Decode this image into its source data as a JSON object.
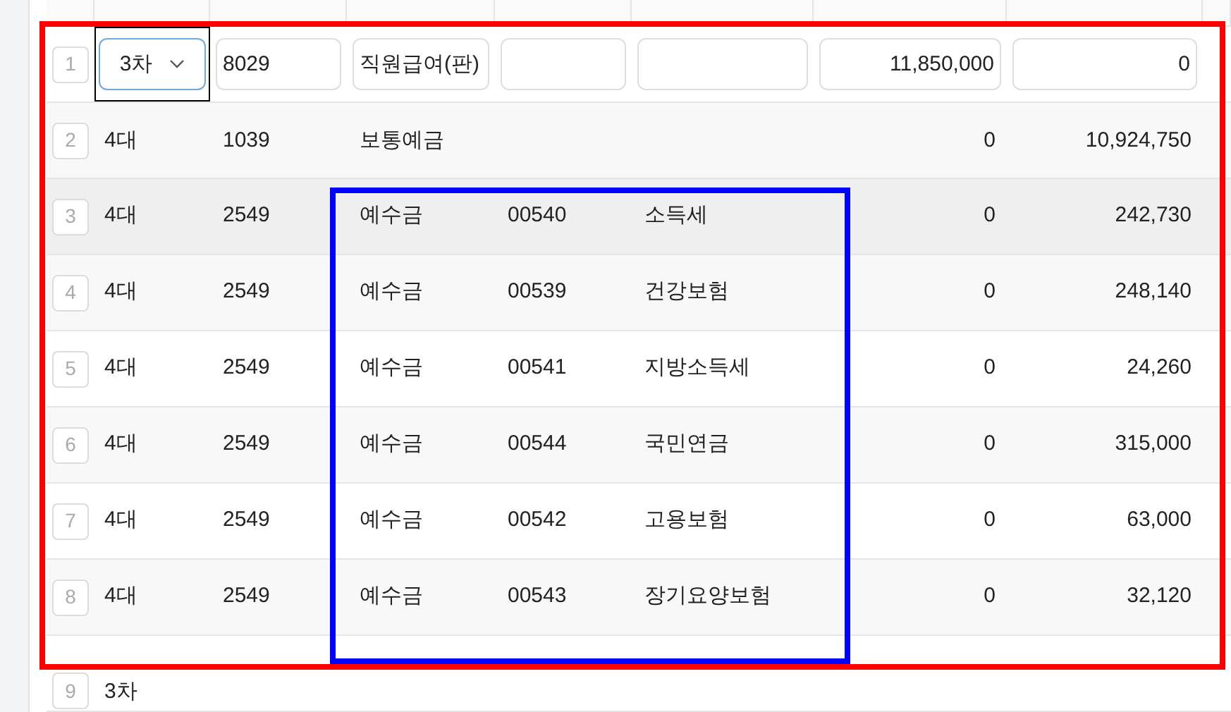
{
  "rows": [
    {
      "number": "1",
      "kind": "edit",
      "type": "3차",
      "account": "8029",
      "account_name": "직원급여(판)",
      "client_code": "",
      "client_name": "",
      "debit": "11,850,000",
      "credit": "0"
    },
    {
      "number": "2",
      "kind": "text",
      "type": "4대",
      "account": "1039",
      "account_name": "보통예금",
      "client_code": "",
      "client_name": "",
      "debit": "0",
      "credit": "10,924,750"
    },
    {
      "number": "3",
      "kind": "text",
      "hovered": true,
      "type": "4대",
      "account": "2549",
      "account_name": "예수금",
      "client_code": "00540",
      "client_name": "소득세",
      "debit": "0",
      "credit": "242,730"
    },
    {
      "number": "4",
      "kind": "text",
      "type": "4대",
      "account": "2549",
      "account_name": "예수금",
      "client_code": "00539",
      "client_name": "건강보험",
      "debit": "0",
      "credit": "248,140"
    },
    {
      "number": "5",
      "kind": "text",
      "type": "4대",
      "account": "2549",
      "account_name": "예수금",
      "client_code": "00541",
      "client_name": "지방소득세",
      "debit": "0",
      "credit": "24,260"
    },
    {
      "number": "6",
      "kind": "text",
      "type": "4대",
      "account": "2549",
      "account_name": "예수금",
      "client_code": "00544",
      "client_name": "국민연금",
      "debit": "0",
      "credit": "315,000"
    },
    {
      "number": "7",
      "kind": "text",
      "type": "4대",
      "account": "2549",
      "account_name": "예수금",
      "client_code": "00542",
      "client_name": "고용보험",
      "debit": "0",
      "credit": "63,000"
    },
    {
      "number": "8",
      "kind": "text",
      "type": "4대",
      "account": "2549",
      "account_name": "예수금",
      "client_code": "00543",
      "client_name": "장기요양보험",
      "debit": "0",
      "credit": "32,120"
    },
    {
      "number": "9",
      "kind": "text",
      "type": "3차",
      "account": "",
      "account_name": "",
      "client_code": "",
      "client_name": "",
      "debit": "",
      "credit": ""
    }
  ],
  "annotations": [
    {
      "color": "#ff0000"
    },
    {
      "color": "#0000ff"
    }
  ]
}
